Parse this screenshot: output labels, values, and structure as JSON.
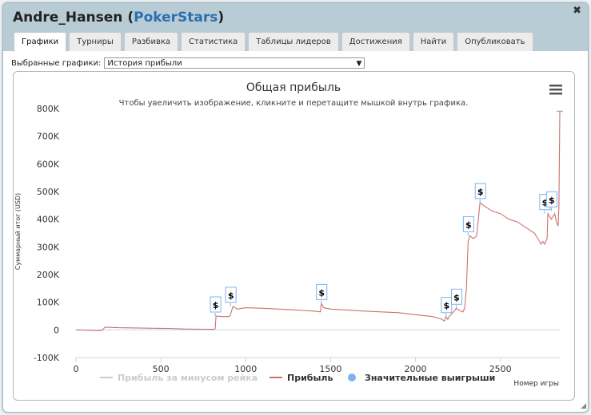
{
  "window": {
    "player": "Andre_Hansen",
    "site": "PokerStars",
    "close_icon": "close-icon"
  },
  "tabs": [
    {
      "label": "Графики",
      "active": true
    },
    {
      "label": "Турниры",
      "active": false
    },
    {
      "label": "Разбивка",
      "active": false
    },
    {
      "label": "Статистика",
      "active": false
    },
    {
      "label": "Таблицы лидеров",
      "active": false
    },
    {
      "label": "Достижения",
      "active": false
    },
    {
      "label": "Найти",
      "active": false
    },
    {
      "label": "Опубликовать",
      "active": false
    }
  ],
  "selector": {
    "label": "Выбранные графики:",
    "value": "История прибыли"
  },
  "colors": {
    "profit": "#c9736e",
    "rake": "#d0d0d0",
    "wins": "#7cb5ec"
  },
  "chart_data": {
    "type": "line",
    "title": "Общая прибыль",
    "subtitle": "Чтобы увеличить изображение, кликните и перетащите мышкой внутрь графика.",
    "ylabel": "Суммарный итог (USD)",
    "xlabel": "Номер игры",
    "xlim": [
      0,
      2850
    ],
    "ylim": [
      -100000,
      800000
    ],
    "x_ticks": [
      0,
      500,
      1000,
      1500,
      2000,
      2500
    ],
    "y_ticks": [
      {
        "value": 800000,
        "label": "800K"
      },
      {
        "value": 700000,
        "label": "700K"
      },
      {
        "value": 600000,
        "label": "600K"
      },
      {
        "value": 500000,
        "label": "500K"
      },
      {
        "value": 400000,
        "label": "400K"
      },
      {
        "value": 300000,
        "label": "300K"
      },
      {
        "value": 200000,
        "label": "200K"
      },
      {
        "value": 100000,
        "label": "100K"
      },
      {
        "value": 0,
        "label": "0"
      },
      {
        "value": -100000,
        "label": "-100K"
      }
    ],
    "legend": [
      {
        "name": "Прибыль за минусом рейка",
        "color": "#d0d0d0",
        "muted": true
      },
      {
        "name": "Прибыль",
        "color": "#c9736e",
        "muted": false
      },
      {
        "name": "Значительные выигрыши",
        "color": "#7cb5ec",
        "muted": false
      }
    ],
    "series": [
      {
        "name": "Прибыль",
        "points": [
          [
            0,
            0
          ],
          [
            150,
            -3000
          ],
          [
            160,
            2000
          ],
          [
            170,
            10000
          ],
          [
            250,
            8000
          ],
          [
            350,
            7000
          ],
          [
            450,
            6000
          ],
          [
            550,
            5000
          ],
          [
            650,
            3000
          ],
          [
            750,
            2000
          ],
          [
            815,
            2000
          ],
          [
            820,
            5000
          ],
          [
            825,
            50000
          ],
          [
            860,
            48000
          ],
          [
            900,
            48000
          ],
          [
            905,
            50000
          ],
          [
            910,
            55000
          ],
          [
            925,
            85000
          ],
          [
            950,
            75000
          ],
          [
            1000,
            80000
          ],
          [
            1100,
            78000
          ],
          [
            1200,
            75000
          ],
          [
            1300,
            72000
          ],
          [
            1400,
            68000
          ],
          [
            1440,
            65000
          ],
          [
            1445,
            95000
          ],
          [
            1460,
            80000
          ],
          [
            1500,
            75000
          ],
          [
            1600,
            72000
          ],
          [
            1700,
            68000
          ],
          [
            1800,
            65000
          ],
          [
            1900,
            62000
          ],
          [
            2000,
            55000
          ],
          [
            2100,
            48000
          ],
          [
            2150,
            40000
          ],
          [
            2170,
            32000
          ],
          [
            2180,
            48000
          ],
          [
            2190,
            38000
          ],
          [
            2200,
            50000
          ],
          [
            2220,
            62000
          ],
          [
            2240,
            78000
          ],
          [
            2260,
            70000
          ],
          [
            2280,
            65000
          ],
          [
            2290,
            80000
          ],
          [
            2300,
            150000
          ],
          [
            2310,
            320000
          ],
          [
            2320,
            340000
          ],
          [
            2340,
            330000
          ],
          [
            2360,
            340000
          ],
          [
            2380,
            460000
          ],
          [
            2400,
            450000
          ],
          [
            2450,
            430000
          ],
          [
            2500,
            420000
          ],
          [
            2550,
            400000
          ],
          [
            2600,
            390000
          ],
          [
            2650,
            370000
          ],
          [
            2700,
            350000
          ],
          [
            2730,
            320000
          ],
          [
            2740,
            310000
          ],
          [
            2750,
            320000
          ],
          [
            2760,
            310000
          ],
          [
            2775,
            330000
          ],
          [
            2780,
            420000
          ],
          [
            2800,
            400000
          ],
          [
            2820,
            420000
          ],
          [
            2830,
            390000
          ],
          [
            2840,
            375000
          ],
          [
            2845,
            450000
          ],
          [
            2850,
            790000
          ]
        ]
      }
    ],
    "markers": [
      {
        "x": 820,
        "y": 50000,
        "label": "$"
      },
      {
        "x": 910,
        "y": 85000,
        "label": "$"
      },
      {
        "x": 1445,
        "y": 95000,
        "label": "$"
      },
      {
        "x": 2180,
        "y": 48000,
        "label": "$"
      },
      {
        "x": 2240,
        "y": 78000,
        "label": "$"
      },
      {
        "x": 2310,
        "y": 340000,
        "label": "$"
      },
      {
        "x": 2380,
        "y": 460000,
        "label": "$"
      },
      {
        "x": 2760,
        "y": 420000,
        "label": "$"
      },
      {
        "x": 2800,
        "y": 430000,
        "label": "$"
      }
    ]
  }
}
